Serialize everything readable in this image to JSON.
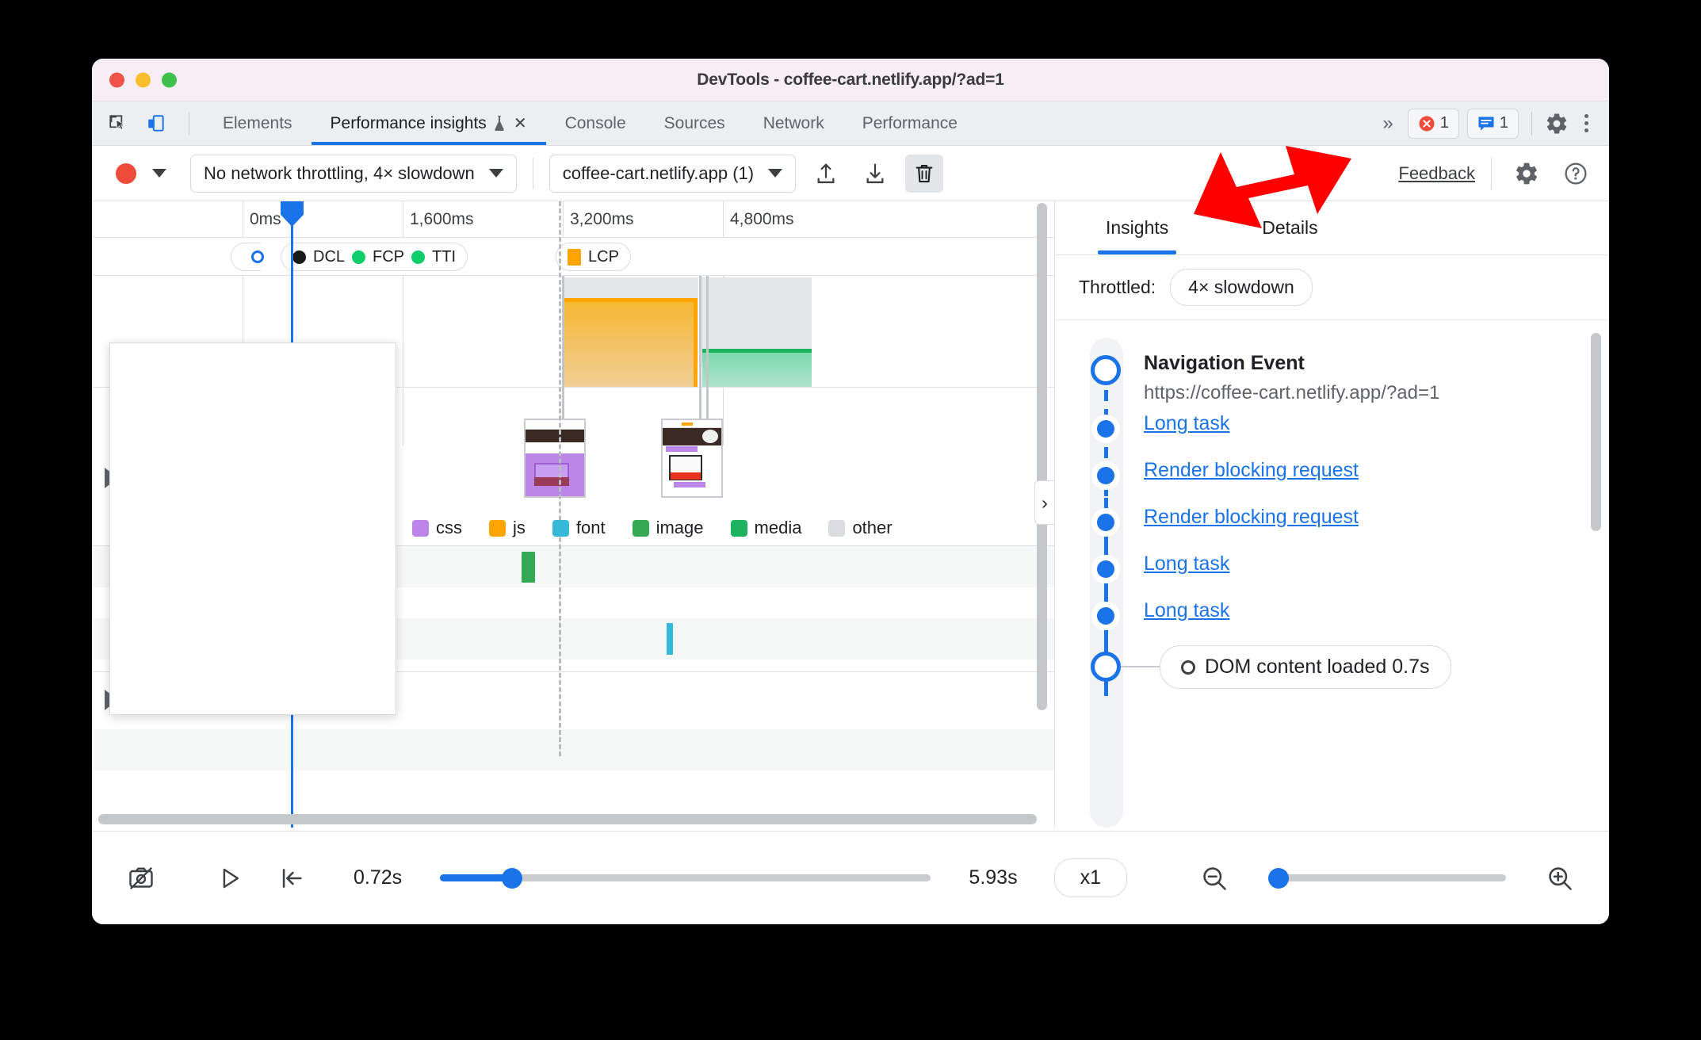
{
  "window": {
    "title": "DevTools - coffee-cart.netlify.app/?ad=1"
  },
  "tabbar": {
    "inspect_icon": "inspect-cursor-icon",
    "device_icon": "device-toolbar-icon",
    "tabs": [
      {
        "label": "Elements",
        "active": false
      },
      {
        "label": "Performance insights",
        "active": true,
        "experimental": true,
        "closable": true
      },
      {
        "label": "Console",
        "active": false
      },
      {
        "label": "Sources",
        "active": false
      },
      {
        "label": "Network",
        "active": false
      },
      {
        "label": "Performance",
        "active": false
      }
    ],
    "more_tabs": "»",
    "error_count": "1",
    "warning_count": "1",
    "settings_icon": "gear-icon",
    "menu_icon": "kebab-menu-icon"
  },
  "toolbar": {
    "record_button": "record-button",
    "record_dropdown": "record-options-caret",
    "throttling": "No network throttling, 4× slowdown",
    "recording_select": "coffee-cart.netlify.app (1)",
    "upload_icon": "upload-icon",
    "download_icon": "download-icon",
    "delete_icon": "trash-icon",
    "feedback": "Feedback",
    "settings_icon": "gear-icon",
    "help_icon": "help-icon"
  },
  "timeline": {
    "ruler_ticks": [
      "0ms",
      "1,600ms",
      "3,200ms",
      "4,800ms"
    ],
    "markers": [
      {
        "label": "DCL",
        "color": "#1a1a1a"
      },
      {
        "label": "FCP",
        "color": "#0cce6b"
      },
      {
        "label": "TTI",
        "color": "#0cce6b"
      },
      {
        "label": "LCP",
        "color": "#ffa400"
      }
    ],
    "legend": [
      {
        "label": "css",
        "color": "#bb86e8"
      },
      {
        "label": "js",
        "color": "#ffa400"
      },
      {
        "label": "font",
        "color": "#36b9d8"
      },
      {
        "label": "image",
        "color": "#34a853"
      },
      {
        "label": "media",
        "color": "#1eb45f"
      },
      {
        "label": "other",
        "color": "#d9dce0"
      }
    ],
    "collapse_handle": "›",
    "track_expanders": [
      "expand-track-arrow",
      "expand-track-arrow"
    ]
  },
  "sidebar": {
    "tabs": [
      {
        "label": "Insights",
        "active": true
      },
      {
        "label": "Details",
        "active": false
      }
    ],
    "throttled_label": "Throttled:",
    "throttled_value": "4× slowdown",
    "event_title": "Navigation Event",
    "event_url": "https://coffee-cart.netlify.app/?ad=1",
    "items": [
      "Long task",
      "Render blocking request",
      "Render blocking request",
      "Long task",
      "Long task"
    ],
    "dcl_marker": "DOM content loaded 0.7s"
  },
  "bottombar": {
    "screenshot_toggle": "screenshot-off-icon",
    "play": "play-icon",
    "jump_start": "jump-to-start-icon",
    "time_start": "0.72s",
    "time_end": "5.93s",
    "speed": "x1",
    "zoom_out": "zoom-out-icon",
    "zoom_in": "zoom-in-icon"
  },
  "annotation": {
    "arrow": "red-pointer-arrow",
    "color": "#ff0000"
  }
}
